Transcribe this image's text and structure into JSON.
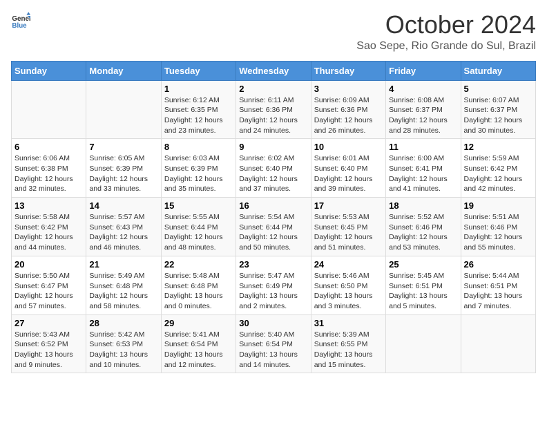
{
  "header": {
    "logo_general": "General",
    "logo_blue": "Blue",
    "title": "October 2024",
    "subtitle": "Sao Sepe, Rio Grande do Sul, Brazil"
  },
  "days_of_week": [
    "Sunday",
    "Monday",
    "Tuesday",
    "Wednesday",
    "Thursday",
    "Friday",
    "Saturday"
  ],
  "weeks": [
    [
      {
        "day": "",
        "sunrise": "",
        "sunset": "",
        "daylight": ""
      },
      {
        "day": "",
        "sunrise": "",
        "sunset": "",
        "daylight": ""
      },
      {
        "day": "1",
        "sunrise": "Sunrise: 6:12 AM",
        "sunset": "Sunset: 6:35 PM",
        "daylight": "Daylight: 12 hours and 23 minutes."
      },
      {
        "day": "2",
        "sunrise": "Sunrise: 6:11 AM",
        "sunset": "Sunset: 6:36 PM",
        "daylight": "Daylight: 12 hours and 24 minutes."
      },
      {
        "day": "3",
        "sunrise": "Sunrise: 6:09 AM",
        "sunset": "Sunset: 6:36 PM",
        "daylight": "Daylight: 12 hours and 26 minutes."
      },
      {
        "day": "4",
        "sunrise": "Sunrise: 6:08 AM",
        "sunset": "Sunset: 6:37 PM",
        "daylight": "Daylight: 12 hours and 28 minutes."
      },
      {
        "day": "5",
        "sunrise": "Sunrise: 6:07 AM",
        "sunset": "Sunset: 6:37 PM",
        "daylight": "Daylight: 12 hours and 30 minutes."
      }
    ],
    [
      {
        "day": "6",
        "sunrise": "Sunrise: 6:06 AM",
        "sunset": "Sunset: 6:38 PM",
        "daylight": "Daylight: 12 hours and 32 minutes."
      },
      {
        "day": "7",
        "sunrise": "Sunrise: 6:05 AM",
        "sunset": "Sunset: 6:39 PM",
        "daylight": "Daylight: 12 hours and 33 minutes."
      },
      {
        "day": "8",
        "sunrise": "Sunrise: 6:03 AM",
        "sunset": "Sunset: 6:39 PM",
        "daylight": "Daylight: 12 hours and 35 minutes."
      },
      {
        "day": "9",
        "sunrise": "Sunrise: 6:02 AM",
        "sunset": "Sunset: 6:40 PM",
        "daylight": "Daylight: 12 hours and 37 minutes."
      },
      {
        "day": "10",
        "sunrise": "Sunrise: 6:01 AM",
        "sunset": "Sunset: 6:40 PM",
        "daylight": "Daylight: 12 hours and 39 minutes."
      },
      {
        "day": "11",
        "sunrise": "Sunrise: 6:00 AM",
        "sunset": "Sunset: 6:41 PM",
        "daylight": "Daylight: 12 hours and 41 minutes."
      },
      {
        "day": "12",
        "sunrise": "Sunrise: 5:59 AM",
        "sunset": "Sunset: 6:42 PM",
        "daylight": "Daylight: 12 hours and 42 minutes."
      }
    ],
    [
      {
        "day": "13",
        "sunrise": "Sunrise: 5:58 AM",
        "sunset": "Sunset: 6:42 PM",
        "daylight": "Daylight: 12 hours and 44 minutes."
      },
      {
        "day": "14",
        "sunrise": "Sunrise: 5:57 AM",
        "sunset": "Sunset: 6:43 PM",
        "daylight": "Daylight: 12 hours and 46 minutes."
      },
      {
        "day": "15",
        "sunrise": "Sunrise: 5:55 AM",
        "sunset": "Sunset: 6:44 PM",
        "daylight": "Daylight: 12 hours and 48 minutes."
      },
      {
        "day": "16",
        "sunrise": "Sunrise: 5:54 AM",
        "sunset": "Sunset: 6:44 PM",
        "daylight": "Daylight: 12 hours and 50 minutes."
      },
      {
        "day": "17",
        "sunrise": "Sunrise: 5:53 AM",
        "sunset": "Sunset: 6:45 PM",
        "daylight": "Daylight: 12 hours and 51 minutes."
      },
      {
        "day": "18",
        "sunrise": "Sunrise: 5:52 AM",
        "sunset": "Sunset: 6:46 PM",
        "daylight": "Daylight: 12 hours and 53 minutes."
      },
      {
        "day": "19",
        "sunrise": "Sunrise: 5:51 AM",
        "sunset": "Sunset: 6:46 PM",
        "daylight": "Daylight: 12 hours and 55 minutes."
      }
    ],
    [
      {
        "day": "20",
        "sunrise": "Sunrise: 5:50 AM",
        "sunset": "Sunset: 6:47 PM",
        "daylight": "Daylight: 12 hours and 57 minutes."
      },
      {
        "day": "21",
        "sunrise": "Sunrise: 5:49 AM",
        "sunset": "Sunset: 6:48 PM",
        "daylight": "Daylight: 12 hours and 58 minutes."
      },
      {
        "day": "22",
        "sunrise": "Sunrise: 5:48 AM",
        "sunset": "Sunset: 6:48 PM",
        "daylight": "Daylight: 13 hours and 0 minutes."
      },
      {
        "day": "23",
        "sunrise": "Sunrise: 5:47 AM",
        "sunset": "Sunset: 6:49 PM",
        "daylight": "Daylight: 13 hours and 2 minutes."
      },
      {
        "day": "24",
        "sunrise": "Sunrise: 5:46 AM",
        "sunset": "Sunset: 6:50 PM",
        "daylight": "Daylight: 13 hours and 3 minutes."
      },
      {
        "day": "25",
        "sunrise": "Sunrise: 5:45 AM",
        "sunset": "Sunset: 6:51 PM",
        "daylight": "Daylight: 13 hours and 5 minutes."
      },
      {
        "day": "26",
        "sunrise": "Sunrise: 5:44 AM",
        "sunset": "Sunset: 6:51 PM",
        "daylight": "Daylight: 13 hours and 7 minutes."
      }
    ],
    [
      {
        "day": "27",
        "sunrise": "Sunrise: 5:43 AM",
        "sunset": "Sunset: 6:52 PM",
        "daylight": "Daylight: 13 hours and 9 minutes."
      },
      {
        "day": "28",
        "sunrise": "Sunrise: 5:42 AM",
        "sunset": "Sunset: 6:53 PM",
        "daylight": "Daylight: 13 hours and 10 minutes."
      },
      {
        "day": "29",
        "sunrise": "Sunrise: 5:41 AM",
        "sunset": "Sunset: 6:54 PM",
        "daylight": "Daylight: 13 hours and 12 minutes."
      },
      {
        "day": "30",
        "sunrise": "Sunrise: 5:40 AM",
        "sunset": "Sunset: 6:54 PM",
        "daylight": "Daylight: 13 hours and 14 minutes."
      },
      {
        "day": "31",
        "sunrise": "Sunrise: 5:39 AM",
        "sunset": "Sunset: 6:55 PM",
        "daylight": "Daylight: 13 hours and 15 minutes."
      },
      {
        "day": "",
        "sunrise": "",
        "sunset": "",
        "daylight": ""
      },
      {
        "day": "",
        "sunrise": "",
        "sunset": "",
        "daylight": ""
      }
    ]
  ]
}
